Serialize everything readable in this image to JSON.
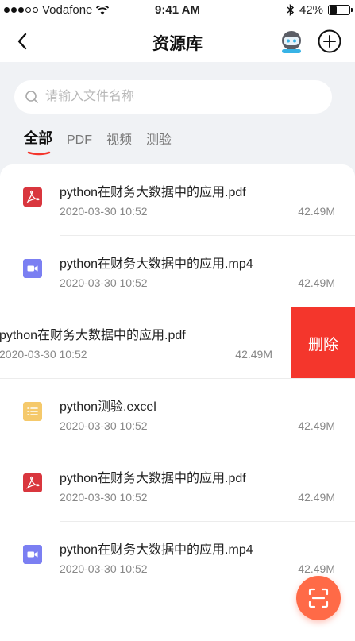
{
  "status_bar": {
    "carrier": "Vodafone",
    "time": "9:41 AM",
    "battery": "42%",
    "battery_level": 0.42
  },
  "header": {
    "title": "资源库"
  },
  "search": {
    "placeholder": "请输入文件名称"
  },
  "tabs": [
    {
      "label": "全部",
      "active": true
    },
    {
      "label": "PDF",
      "active": false
    },
    {
      "label": "视频",
      "active": false
    },
    {
      "label": "测验",
      "active": false
    }
  ],
  "files": [
    {
      "name": "python在财务大数据中的应用.pdf",
      "date": "2020-03-30 10:52",
      "size": "42.49M",
      "icon": "pdf-icon"
    },
    {
      "name": "python在财务大数据中的应用.mp4",
      "date": "2020-03-30 10:52",
      "size": "42.49M",
      "icon": "video-icon"
    },
    {
      "name": "python在财务大数据中的应用.pdf",
      "date": "2020-03-30 10:52",
      "size": "42.49M",
      "icon": "pdf-icon",
      "swiped": true,
      "delete_label": "删除"
    },
    {
      "name": "python测验.excel",
      "date": "2020-03-30 10:52",
      "size": "42.49M",
      "icon": "quiz-icon"
    },
    {
      "name": "python在财务大数据中的应用.pdf",
      "date": "2020-03-30 10:52",
      "size": "42.49M",
      "icon": "pdf-icon"
    },
    {
      "name": "python在财务大数据中的应用.mp4",
      "date": "2020-03-30 10:52",
      "size": "42.49M",
      "icon": "video-icon"
    }
  ],
  "colors": {
    "accent": "#f4362c",
    "fab": "#ff6a47",
    "pdf": "#d9363e",
    "video": "#7b7ff2",
    "quiz": "#f5c96b"
  }
}
